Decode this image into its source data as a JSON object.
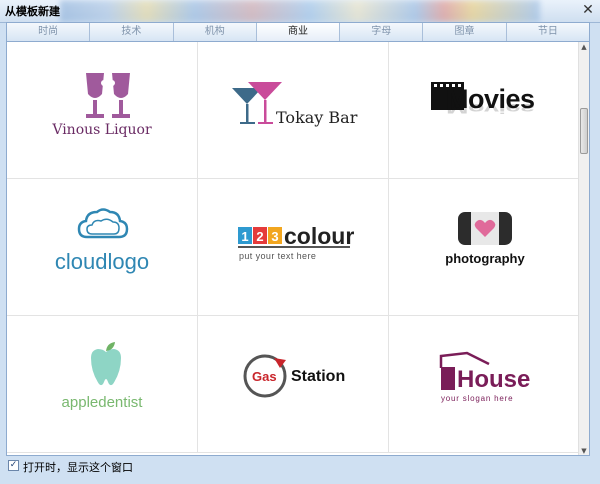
{
  "window": {
    "title": "从模板新建",
    "close_glyph": "✕"
  },
  "tabs": [
    {
      "label": "时尚",
      "active": false
    },
    {
      "label": "技术",
      "active": false
    },
    {
      "label": "机构",
      "active": false
    },
    {
      "label": "商业",
      "active": true
    },
    {
      "label": "字母",
      "active": false
    },
    {
      "label": "图章",
      "active": false
    },
    {
      "label": "节日",
      "active": false
    }
  ],
  "templates": {
    "vinous": {
      "name": "Vinous Liquor"
    },
    "tokay": {
      "name": "Tokay Bar"
    },
    "movies": {
      "name": "Movies"
    },
    "cloud": {
      "name": "cloudlogo"
    },
    "colour": {
      "digits": [
        "1",
        "2",
        "3"
      ],
      "name": "colour",
      "slogan": "put your text  here"
    },
    "photo": {
      "name": "photography"
    },
    "apple": {
      "name": "appledentist"
    },
    "gas": {
      "prefix": "Gas",
      "name": "Station"
    },
    "house": {
      "name": "House",
      "slogan": "your slogan here"
    }
  },
  "footer": {
    "checkbox_checked": true,
    "checkbox_glyph": "✓",
    "label": "打开时，显示这个窗口"
  },
  "scrollbar": {
    "up_glyph": "▲",
    "down_glyph": "▼"
  },
  "colors": {
    "vinous": "#a05a9c",
    "tokay_pink": "#c94b9a",
    "cloud_blue": "#2f87b3",
    "colour_1": "#2e9ad0",
    "colour_2": "#e53b3b",
    "colour_3": "#f2a61f",
    "photo_heart": "#e06a9a",
    "apple_mint": "#8ed5c5",
    "gas_red": "#c9252b",
    "house_purple": "#7a1d58"
  }
}
